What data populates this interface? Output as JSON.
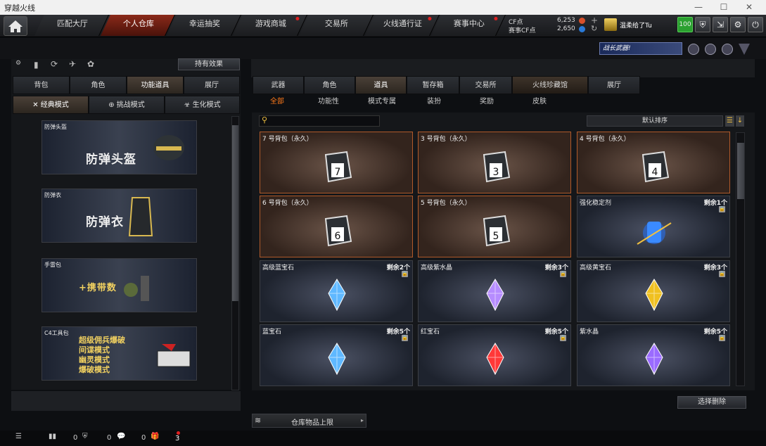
{
  "window": {
    "title": "穿越火线",
    "controls": [
      "—",
      "☐",
      "✕"
    ]
  },
  "nav": {
    "tabs": [
      "匹配大厅",
      "个人仓库",
      "幸运抽奖",
      "游戏商城",
      "交易所",
      "火线通行证",
      "赛事中心"
    ],
    "active_tab": "个人仓库",
    "cf_label": "CF点",
    "cf_value": "6,253",
    "cf2_label": "赛事CF点",
    "cf2_value": "2,650",
    "username": "温柔给了Tu",
    "level": "100"
  },
  "banner": {
    "text": "战长武器!"
  },
  "left": {
    "effects_button": "持有效果",
    "tabs": [
      "背包",
      "角色",
      "功能道具",
      "展厅"
    ],
    "active_tab": "功能道具",
    "modes": [
      "经典模式",
      "挑战模式",
      "生化模式"
    ],
    "active_mode": "经典模式",
    "cards": [
      {
        "label": "防弹头盔",
        "title": "防弹头盔"
      },
      {
        "label": "防弹衣",
        "title": "防弹衣"
      },
      {
        "label": "手雷包",
        "title": "+携带数"
      },
      {
        "label": "C4工具包",
        "lines": [
          "超级佣兵爆破",
          "间谍模式",
          "幽灵模式",
          "爆破模式"
        ]
      }
    ]
  },
  "right": {
    "tabs": [
      "武器",
      "角色",
      "道具",
      "暂存箱",
      "交易所",
      "火线珍藏馆",
      "展厅"
    ],
    "active_tab": "道具",
    "subtabs": [
      "全部",
      "功能性",
      "模式专属",
      "装扮",
      "奖励",
      "皮肤"
    ],
    "active_subtab": "全部",
    "search_placeholder": "",
    "sort_label": "默认排序",
    "items": [
      {
        "name": "7 号背包（永久）",
        "type": "bag",
        "bag_no": "7"
      },
      {
        "name": "3 号背包（永久）",
        "type": "bag",
        "bag_no": "3"
      },
      {
        "name": "4 号背包（永久）",
        "type": "bag",
        "bag_no": "4"
      },
      {
        "name": "6 号背包（永久）",
        "type": "bag",
        "bag_no": "6"
      },
      {
        "name": "5 号背包（永久）",
        "type": "bag",
        "bag_no": "5"
      },
      {
        "name": "强化稳定剂",
        "type": "item",
        "count": "剩余1个",
        "icon": "stabilizer-icon"
      },
      {
        "name": "高级蓝宝石",
        "type": "gem",
        "count": "剩余2个",
        "gem_color": "#5fb8ff"
      },
      {
        "name": "高级紫水晶",
        "type": "gem",
        "count": "剩余3个",
        "gem_color": "#b68cff"
      },
      {
        "name": "高级黄宝石",
        "type": "gem",
        "count": "剩余3个",
        "gem_color": "#f0c020"
      },
      {
        "name": "蓝宝石",
        "type": "gem",
        "count": "剩余5个",
        "gem_color": "#5fb8ff"
      },
      {
        "name": "红宝石",
        "type": "gem",
        "count": "剩余5个",
        "gem_color": "#ff3838"
      },
      {
        "name": "紫水晶",
        "type": "gem",
        "count": "剩余5个",
        "gem_color": "#9a6bff"
      }
    ],
    "delete_button": "选择删除",
    "capacity_label": "仓库物品上限"
  },
  "statusbar": {
    "friends": "0",
    "shield": "0",
    "chat": "0",
    "gift": "3"
  }
}
